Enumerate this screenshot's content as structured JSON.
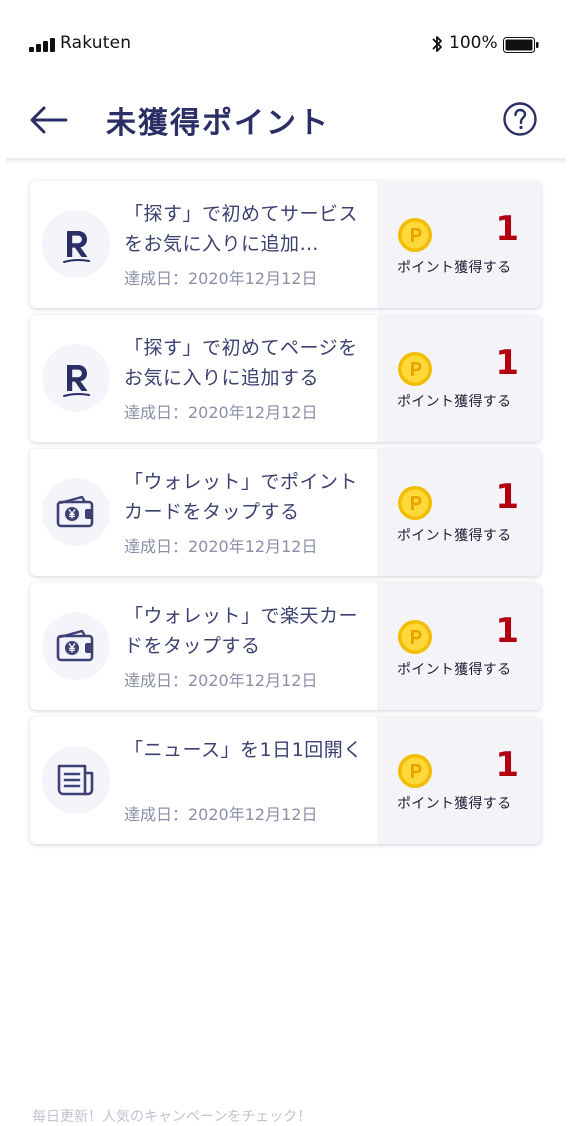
{
  "status_bar": {
    "carrier": "Rakuten",
    "battery": "100%"
  },
  "header": {
    "title": "未獲得ポイント",
    "back_icon": "arrow-left-icon",
    "help_icon": "question-circle-icon"
  },
  "cards": [
    {
      "icon": "rakuten-r-icon",
      "title": "「探す」で初めてサービスをお気に入りに追加…",
      "date": "達成日：2020年12月12日",
      "points": "1",
      "points_label": "ポイント獲得する"
    },
    {
      "icon": "rakuten-r-icon",
      "title": "「探す」で初めてページをお気に入りに追加する",
      "date": "達成日：2020年12月12日",
      "points": "1",
      "points_label": "ポイント獲得する"
    },
    {
      "icon": "wallet-yen-icon",
      "title": "「ウォレット」でポイントカードをタップする",
      "date": "達成日：2020年12月12日",
      "points": "1",
      "points_label": "ポイント獲得する"
    },
    {
      "icon": "wallet-yen-icon",
      "title": "「ウォレット」で楽天カードをタップする",
      "date": "達成日：2020年12月12日",
      "points": "1",
      "points_label": "ポイント獲得する"
    },
    {
      "icon": "news-icon",
      "title": "「ニュース」を1日1回開く",
      "date": "達成日：2020年12月12日",
      "points": "1",
      "points_label": "ポイント獲得する"
    }
  ],
  "bottom_banner": "毎日更新！人気のキャンペーンをチェック！",
  "colors": {
    "title": "#2a2f66",
    "points": "#b20012",
    "coin": "#f5c400",
    "points_panel": "#f4f4f8"
  }
}
